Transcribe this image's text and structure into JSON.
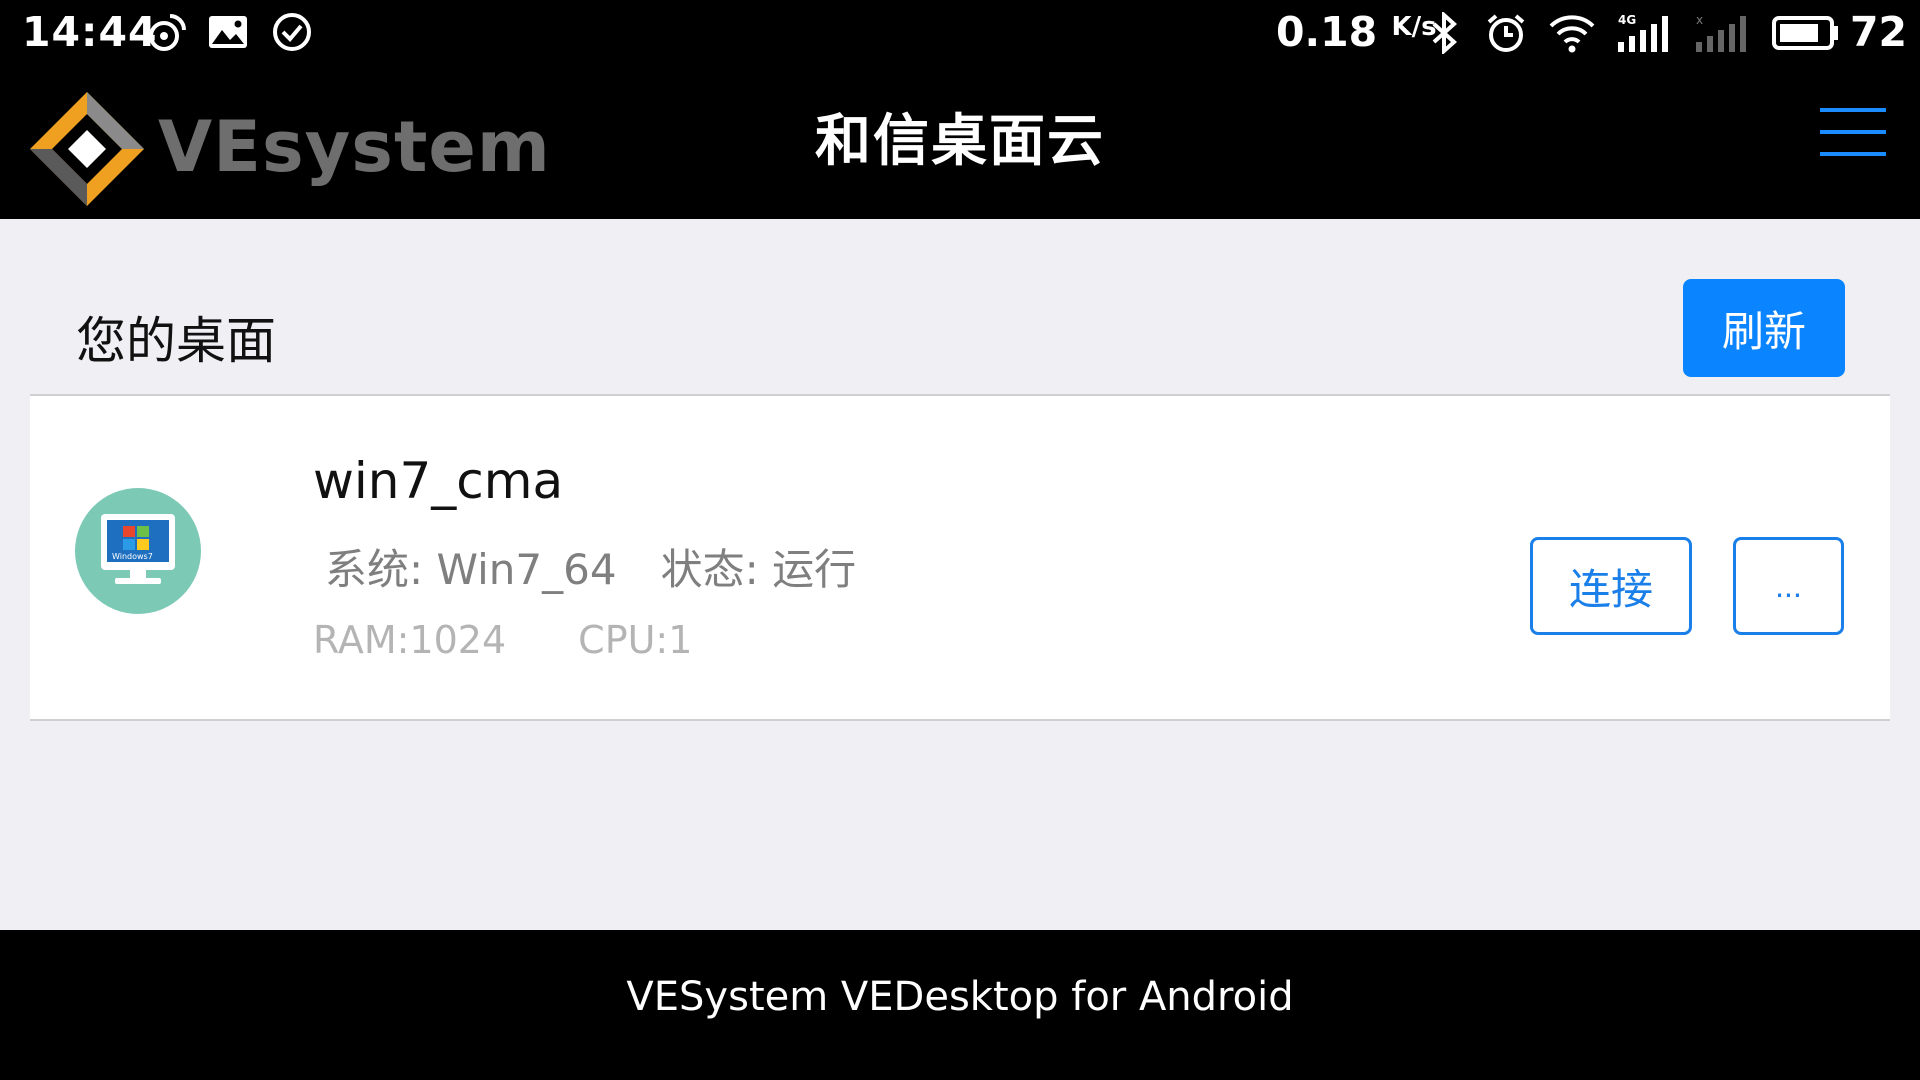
{
  "status_bar": {
    "time": "14:44",
    "net_speed": "0.18",
    "net_speed_unit": "K/s",
    "battery": "72",
    "icons": [
      "weibo-icon",
      "image-icon",
      "check-circle-icon",
      "bluetooth-icon",
      "alarm-icon",
      "wifi-icon",
      "signal-4g-icon",
      "signal-empty-icon",
      "battery-icon"
    ]
  },
  "header": {
    "logo_text": "VEsystem",
    "title": "和信桌面云",
    "menu_icon": "hamburger-menu-icon",
    "accent_color": "#1a8cff"
  },
  "main": {
    "section_title": "您的桌面",
    "refresh_label": "刷新",
    "desktops": [
      {
        "name": "win7_cma",
        "system_label": "系统: Win7_64",
        "status_label": "状态: 运行",
        "ram_label": "RAM:1024",
        "cpu_label": "CPU:1",
        "icon": "windows7-monitor-icon",
        "connect_label": "连接",
        "more_label": "..."
      }
    ]
  },
  "footer": {
    "text": "VESystem VEDesktop for Android"
  }
}
